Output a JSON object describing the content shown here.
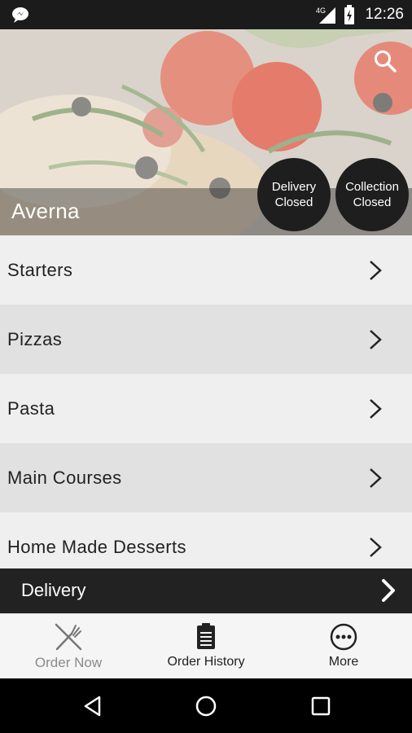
{
  "status_bar": {
    "time": "12:26",
    "network": "4G"
  },
  "restaurant": {
    "name": "Averna",
    "delivery_status": {
      "line1": "Delivery",
      "line2": "Closed"
    },
    "collection_status": {
      "line1": "Collection",
      "line2": "Closed"
    }
  },
  "menu": {
    "categories": [
      {
        "label": "Starters"
      },
      {
        "label": "Pizzas"
      },
      {
        "label": "Pasta"
      },
      {
        "label": "Main Courses"
      },
      {
        "label": "Home Made Desserts"
      }
    ]
  },
  "order_mode": {
    "label": "Delivery"
  },
  "bottom_nav": {
    "tabs": [
      {
        "label": "Order Now",
        "icon": "fork-knife-icon"
      },
      {
        "label": "Order History",
        "icon": "clipboard-icon"
      },
      {
        "label": "More",
        "icon": "more-dots-icon"
      }
    ]
  },
  "icons": {
    "status_left": "messenger-icon",
    "search": "search-icon",
    "chevron": "chevron-right-icon",
    "nav_back": "back-triangle-icon",
    "nav_home": "home-circle-icon",
    "nav_recents": "recents-square-icon"
  },
  "colors": {
    "status_bar": "#1b1b1b",
    "badge": "#1e1e1e",
    "delivery_bar": "#222222",
    "menu_light": "#efefef",
    "menu_dark": "#e1e1e1"
  }
}
